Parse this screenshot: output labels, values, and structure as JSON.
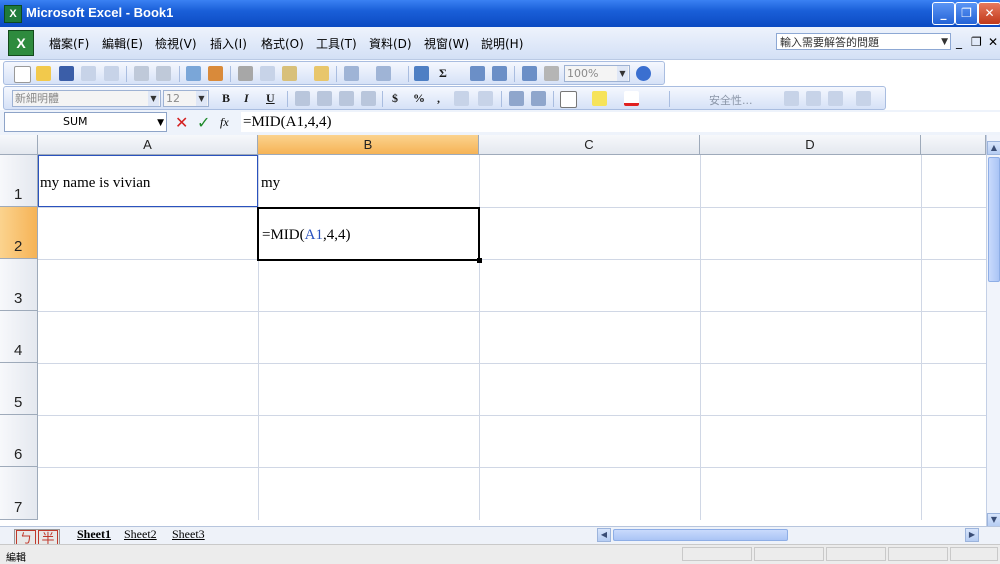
{
  "window": {
    "title": "Microsoft Excel - Book1",
    "app_icon": "excel-icon"
  },
  "menu": [
    "檔案(F)",
    "編輯(E)",
    "檢視(V)",
    "插入(I)",
    "格式(O)",
    "工具(T)",
    "資料(D)",
    "視窗(W)",
    "說明(H)"
  ],
  "help_search": {
    "placeholder": "輸入需要解答的問題"
  },
  "toolbar": {
    "zoom": "100%",
    "font_name": "新細明體",
    "font_size": "12",
    "bold": "B",
    "italic": "I",
    "underline": "U",
    "currency": "$",
    "percent": "%",
    "comma": ",",
    "autosum": "Σ",
    "security_label": "安全性..."
  },
  "formula_bar": {
    "name_box": "SUM",
    "fx": "fx",
    "formula": "=MID(A1,4,4)"
  },
  "columns": [
    "A",
    "B",
    "C",
    "D"
  ],
  "rows": [
    "1",
    "2",
    "3",
    "4",
    "5",
    "6",
    "7"
  ],
  "cells": {
    "A1": "my name is vivian",
    "B1": "my",
    "B2_prefix": "=MID(",
    "B2_ref": "A1",
    "B2_suffix": ",4,4)"
  },
  "sheets": [
    "Sheet1",
    "Sheet2",
    "Sheet3"
  ],
  "status": {
    "mode": "編輯"
  },
  "ime": [
    "ㄅ",
    "半"
  ],
  "colors": {
    "selected_header": "#f6b356",
    "reference_blue": "#2a52be",
    "titlebar": "#1a5fd8"
  }
}
